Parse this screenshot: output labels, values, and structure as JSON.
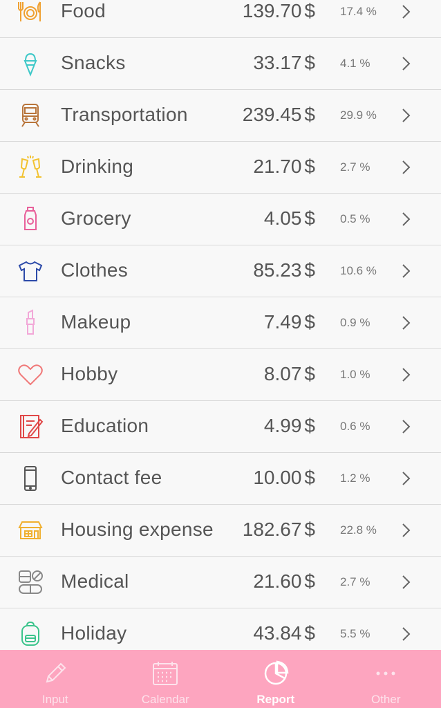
{
  "categories": [
    {
      "name": "Food",
      "amount": "139.70",
      "currency": "$",
      "percent": "17.4 %",
      "icon": "fork-knife-plate-icon",
      "color": "#f0a030"
    },
    {
      "name": "Snacks",
      "amount": "33.17",
      "currency": "$",
      "percent": "4.1 %",
      "icon": "ice-cream-icon",
      "color": "#3ec8c8"
    },
    {
      "name": "Transportation",
      "amount": "239.45",
      "currency": "$",
      "percent": "29.9 %",
      "icon": "train-icon",
      "color": "#b8743a"
    },
    {
      "name": "Drinking",
      "amount": "21.70",
      "currency": "$",
      "percent": "2.7 %",
      "icon": "champagne-icon",
      "color": "#f2c230"
    },
    {
      "name": "Grocery",
      "amount": "4.05",
      "currency": "$",
      "percent": "0.5 %",
      "icon": "detergent-bottle-icon",
      "color": "#e8609a"
    },
    {
      "name": "Clothes",
      "amount": "85.23",
      "currency": "$",
      "percent": "10.6 %",
      "icon": "tshirt-icon",
      "color": "#2c4aa8"
    },
    {
      "name": "Makeup",
      "amount": "7.49",
      "currency": "$",
      "percent": "0.9 %",
      "icon": "lipstick-icon",
      "color": "#f2a8d8"
    },
    {
      "name": "Hobby",
      "amount": "8.07",
      "currency": "$",
      "percent": "1.0 %",
      "icon": "heart-icon",
      "color": "#f07878"
    },
    {
      "name": "Education",
      "amount": "4.99",
      "currency": "$",
      "percent": "0.6 %",
      "icon": "notebook-pencil-icon",
      "color": "#e04848"
    },
    {
      "name": "Contact fee",
      "amount": "10.00",
      "currency": "$",
      "percent": "1.2 %",
      "icon": "smartphone-icon",
      "color": "#555555"
    },
    {
      "name": "Housing expense",
      "amount": "182.67",
      "currency": "$",
      "percent": "22.8 %",
      "icon": "house-icon",
      "color": "#f0b030"
    },
    {
      "name": "Medical",
      "amount": "21.60",
      "currency": "$",
      "percent": "2.7 %",
      "icon": "pills-icon",
      "color": "#888888"
    },
    {
      "name": "Holiday",
      "amount": "43.84",
      "currency": "$",
      "percent": "5.5 %",
      "icon": "backpack-icon",
      "color": "#3cc48c"
    }
  ],
  "tabbar": {
    "tabs": [
      {
        "label": "Input",
        "icon": "pencil-icon",
        "active": false
      },
      {
        "label": "Calendar",
        "icon": "calendar-icon",
        "active": false
      },
      {
        "label": "Report",
        "icon": "pie-chart-icon",
        "active": true
      },
      {
        "label": "Other",
        "icon": "more-dots-icon",
        "active": false
      }
    ]
  }
}
